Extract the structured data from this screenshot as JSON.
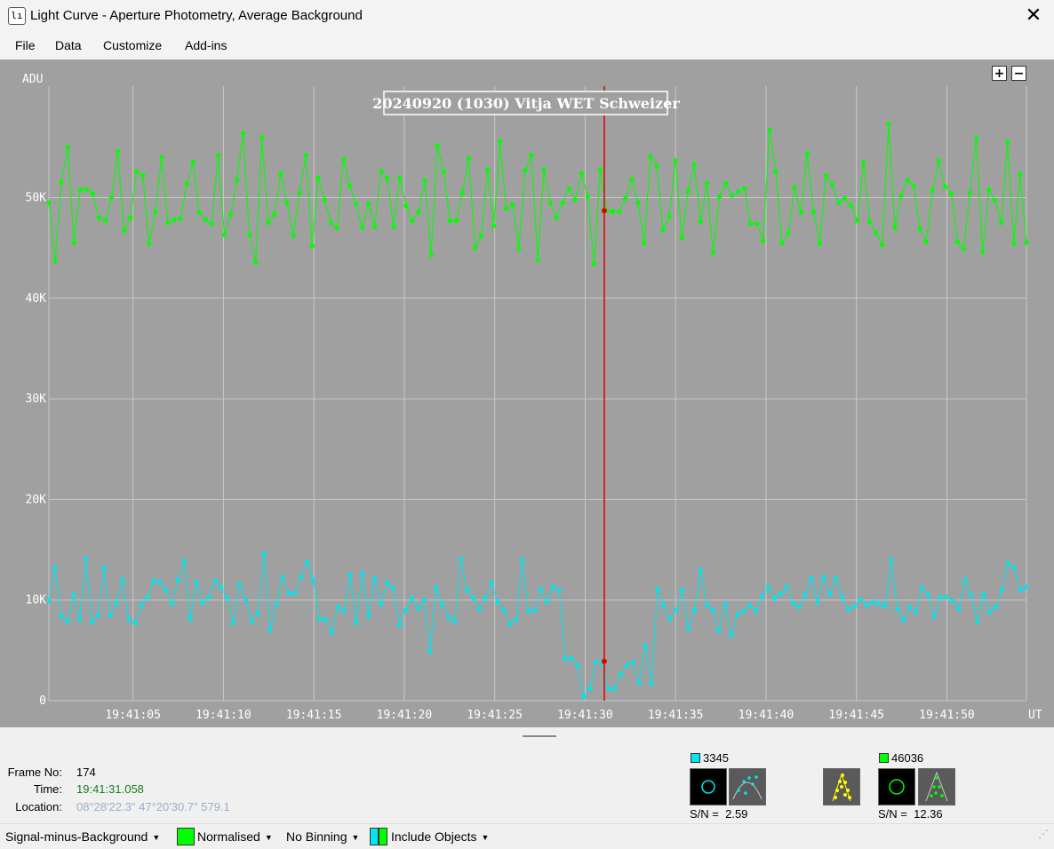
{
  "window": {
    "title": "Light Curve - Aperture Photometry, Average Background",
    "icon": "light-curve-app-icon",
    "close_glyph": "✕"
  },
  "menu": [
    "File",
    "Data",
    "Customize",
    "Add-ins"
  ],
  "plot": {
    "title": "20240920 (1030) Vitja WET Schweizer",
    "y_unit": "ADU",
    "x_unit": "UT",
    "zoom_in": "+",
    "zoom_out": "−",
    "background_color": "#a0a0a0"
  },
  "chart_data": {
    "type": "line",
    "xlabel": "UT",
    "ylabel": "ADU",
    "ylim": [
      0,
      61000
    ],
    "xlim": [
      "19:41:00.35",
      "19:41:54.40"
    ],
    "y_ticks": [
      "0",
      "10K",
      "20K",
      "30K",
      "40K",
      "50K"
    ],
    "x_ticks": [
      "19:41:05",
      "19:41:10",
      "19:41:15",
      "19:41:20",
      "19:41:25",
      "19:41:30",
      "19:41:35",
      "19:41:40",
      "19:41:45",
      "19:41:50"
    ],
    "cursor": {
      "frame": 174,
      "time": "19:41:31.058"
    },
    "series": [
      {
        "id": "46036",
        "color": "#00ff00",
        "values": [
          49500,
          43700,
          51500,
          55000,
          45500,
          50800,
          50800,
          50400,
          48000,
          47700,
          50000,
          54600,
          46700,
          48000,
          52600,
          52200,
          45400,
          48600,
          54000,
          47500,
          47800,
          47900,
          51400,
          53500,
          48500,
          47800,
          47400,
          54200,
          46300,
          48300,
          51800,
          56400,
          46300,
          43600,
          56000,
          47500,
          48300,
          52400,
          49500,
          46200,
          50500,
          54200,
          45200,
          52000,
          49800,
          47500,
          47000,
          53800,
          51200,
          49400,
          47000,
          49400,
          47100,
          52600,
          51900,
          47100,
          52000,
          49200,
          47700,
          48600,
          51700,
          44300,
          55200,
          52600,
          47700,
          47700,
          50500,
          53900,
          45000,
          46200,
          52800,
          47200,
          55600,
          48900,
          49300,
          44900,
          52700,
          54200,
          43800,
          52800,
          49500,
          48000,
          49500,
          50900,
          49800,
          52400,
          50100,
          43400,
          52800,
          48700,
          48600,
          48600,
          49900,
          51800,
          49500,
          45400,
          54100,
          53100,
          46800,
          48100,
          53700,
          46000,
          50600,
          53300,
          47600,
          51400,
          44500,
          50100,
          51400,
          50200,
          50600,
          50900,
          47400,
          47400,
          45700,
          56700,
          52600,
          45500,
          46500,
          51000,
          48500,
          54400,
          48600,
          45400,
          52200,
          51300,
          49500,
          49900,
          49200,
          47700,
          53500,
          47600,
          46500,
          45300,
          57300,
          47000,
          50200,
          51700,
          51200,
          46900,
          45600,
          50700,
          53700,
          51100,
          50400,
          45600,
          44900,
          50500,
          55900,
          44600,
          50800,
          49700,
          47500,
          55500,
          45400,
          52300,
          45500
        ]
      },
      {
        "id": "3345",
        "color": "#00e5ee",
        "values": [
          9900,
          13200,
          8400,
          7900,
          10500,
          8100,
          14100,
          7800,
          8500,
          13200,
          8500,
          9700,
          12000,
          8100,
          7700,
          9500,
          10300,
          11900,
          11800,
          11000,
          9600,
          12000,
          13900,
          8100,
          11800,
          9700,
          10300,
          11900,
          11300,
          10200,
          7700,
          11600,
          10000,
          7900,
          8700,
          14600,
          7000,
          9600,
          12300,
          10700,
          10700,
          12300,
          13800,
          12000,
          8100,
          8100,
          6800,
          9300,
          8900,
          12500,
          7700,
          12700,
          8400,
          12200,
          9600,
          11700,
          11200,
          7500,
          9000,
          10200,
          9200,
          10000,
          4900,
          11200,
          9600,
          8300,
          7900,
          14100,
          11000,
          10200,
          9100,
          10200,
          11700,
          9800,
          9000,
          7600,
          8100,
          14000,
          8900,
          9000,
          11100,
          9800,
          11300,
          11000,
          4200,
          4200,
          3500,
          400,
          1200,
          3800,
          3900,
          1200,
          1200,
          2600,
          3500,
          3800,
          1800,
          5500,
          1700,
          11100,
          9500,
          8100,
          9000,
          11000,
          7100,
          9000,
          13000,
          9500,
          9000,
          6900,
          9600,
          6500,
          8600,
          8900,
          9500,
          8900,
          10400,
          11300,
          10200,
          10600,
          11300,
          9700,
          9300,
          10500,
          12200,
          9800,
          12300,
          10600,
          12200,
          10300,
          9100,
          9400,
          10100,
          9500,
          9800,
          9700,
          9400,
          14000,
          9100,
          8000,
          9300,
          8800,
          11200,
          10500,
          8400,
          10300,
          10300,
          9900,
          9100,
          12000,
          10500,
          7800,
          10600,
          8800,
          9300,
          11000,
          13600,
          13200,
          11000,
          11300
        ]
      }
    ]
  },
  "info": {
    "frame_label": "Frame No:",
    "frame_value": "174",
    "time_label": "Time:",
    "time_value": "19:41:31.058",
    "location_label": "Location:",
    "location_value": "08°28'22.3\" 47°20'30.7\" 579.1"
  },
  "objects": [
    {
      "id": "3345",
      "color": "#00e5ee",
      "sn_label": "S/N =",
      "sn_value": "2.59",
      "icons": [
        "aperture-ring-icon",
        "psf-fit-icon"
      ]
    },
    {
      "id": "46036",
      "color": "#00ff00",
      "sn_label": "S/N =",
      "sn_value": "12.36",
      "icons": [
        "aperture-ring-icon",
        "psf-fit-icon"
      ]
    }
  ],
  "status": {
    "signal": "Signal-minus-Background",
    "normalised": "Normalised",
    "binning": "No Binning",
    "include": "Include Objects",
    "normalised_color": "#00ff00",
    "include_colors": [
      "#00e5ee",
      "#00ff00"
    ]
  }
}
